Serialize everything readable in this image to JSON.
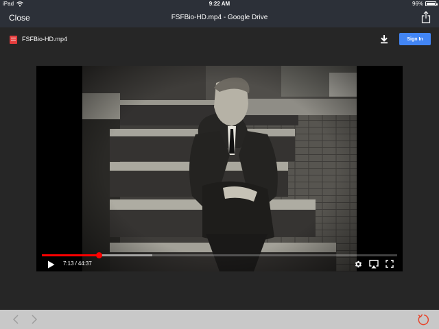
{
  "status_bar": {
    "device": "iPad",
    "time": "9:22 AM",
    "battery_text": "96%",
    "battery_level": 0.96
  },
  "nav": {
    "close_label": "Close",
    "title": "FSFBio-HD.mp4 - Google Drive"
  },
  "drive_bar": {
    "file_name": "FSFBio-HD.mp4",
    "sign_in_label": "Sign In"
  },
  "player": {
    "current_time": "7:13",
    "separator": "/",
    "duration": "44:37",
    "played_fraction": 0.162,
    "buffered_fraction": 0.31
  },
  "icons": {
    "wifi": "wifi-icon",
    "share": "share-icon",
    "file": "video-file-icon",
    "download": "download-icon",
    "play": "play-icon",
    "settings": "gear-icon",
    "airplay": "airplay-icon",
    "fullscreen": "fullscreen-icon",
    "back": "chevron-left-icon",
    "forward": "chevron-right-icon",
    "reload": "reload-icon"
  },
  "colors": {
    "chrome": "#2c3038",
    "background": "#262626",
    "sign_in": "#4285f4",
    "progress": "#ff0000",
    "file_icon": "#e43d3d",
    "reload": "#e8452c"
  }
}
